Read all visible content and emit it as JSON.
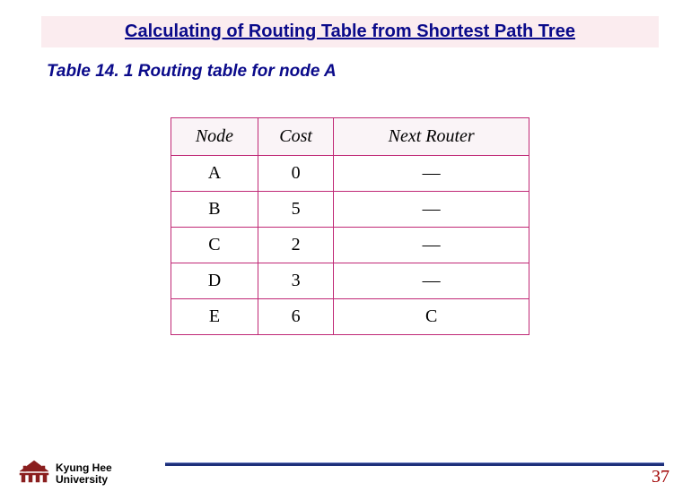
{
  "title": "Calculating of Routing Table from Shortest Path Tree",
  "caption": "Table 14. 1  Routing table for node A",
  "table": {
    "headers": {
      "c0": "Node",
      "c1": "Cost",
      "c2": "Next Router"
    },
    "rows": [
      {
        "c0": "A",
        "c1": "0",
        "c2": "—"
      },
      {
        "c0": "B",
        "c1": "5",
        "c2": "—"
      },
      {
        "c0": "C",
        "c1": "2",
        "c2": "—"
      },
      {
        "c0": "D",
        "c1": "3",
        "c2": "—"
      },
      {
        "c0": "E",
        "c1": "6",
        "c2": "C"
      }
    ]
  },
  "footer": {
    "institution_line1": "Kyung Hee",
    "institution_line2": "University",
    "page": "37"
  },
  "chart_data": {
    "type": "table",
    "title": "Table 14.1  Routing table for node A",
    "columns": [
      "Node",
      "Cost",
      "Next Router"
    ],
    "rows": [
      [
        "A",
        0,
        "—"
      ],
      [
        "B",
        5,
        "—"
      ],
      [
        "C",
        2,
        "—"
      ],
      [
        "D",
        3,
        "—"
      ],
      [
        "E",
        6,
        "C"
      ]
    ]
  }
}
